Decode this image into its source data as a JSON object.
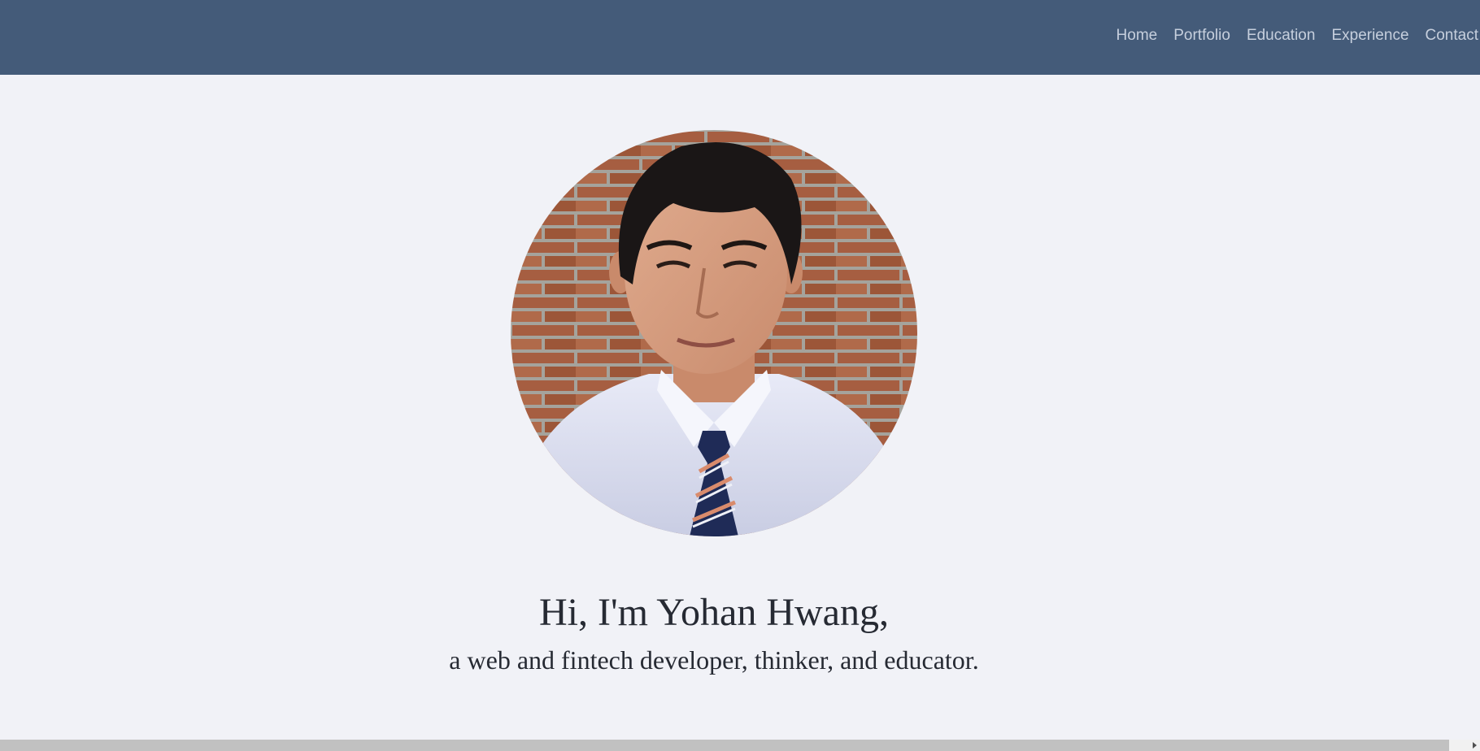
{
  "nav": {
    "items": [
      {
        "label": "Home"
      },
      {
        "label": "Portfolio"
      },
      {
        "label": "Education"
      },
      {
        "label": "Experience"
      },
      {
        "label": "Contact"
      }
    ]
  },
  "hero": {
    "headline": "Hi, I'm Yohan Hwang,",
    "subtitle": "a web and fintech developer, thinker, and educator."
  },
  "colors": {
    "nav_background": "#445b79",
    "page_background": "#f1f2f7",
    "nav_text": "#c6cfdd",
    "heading_text": "#262a33"
  }
}
